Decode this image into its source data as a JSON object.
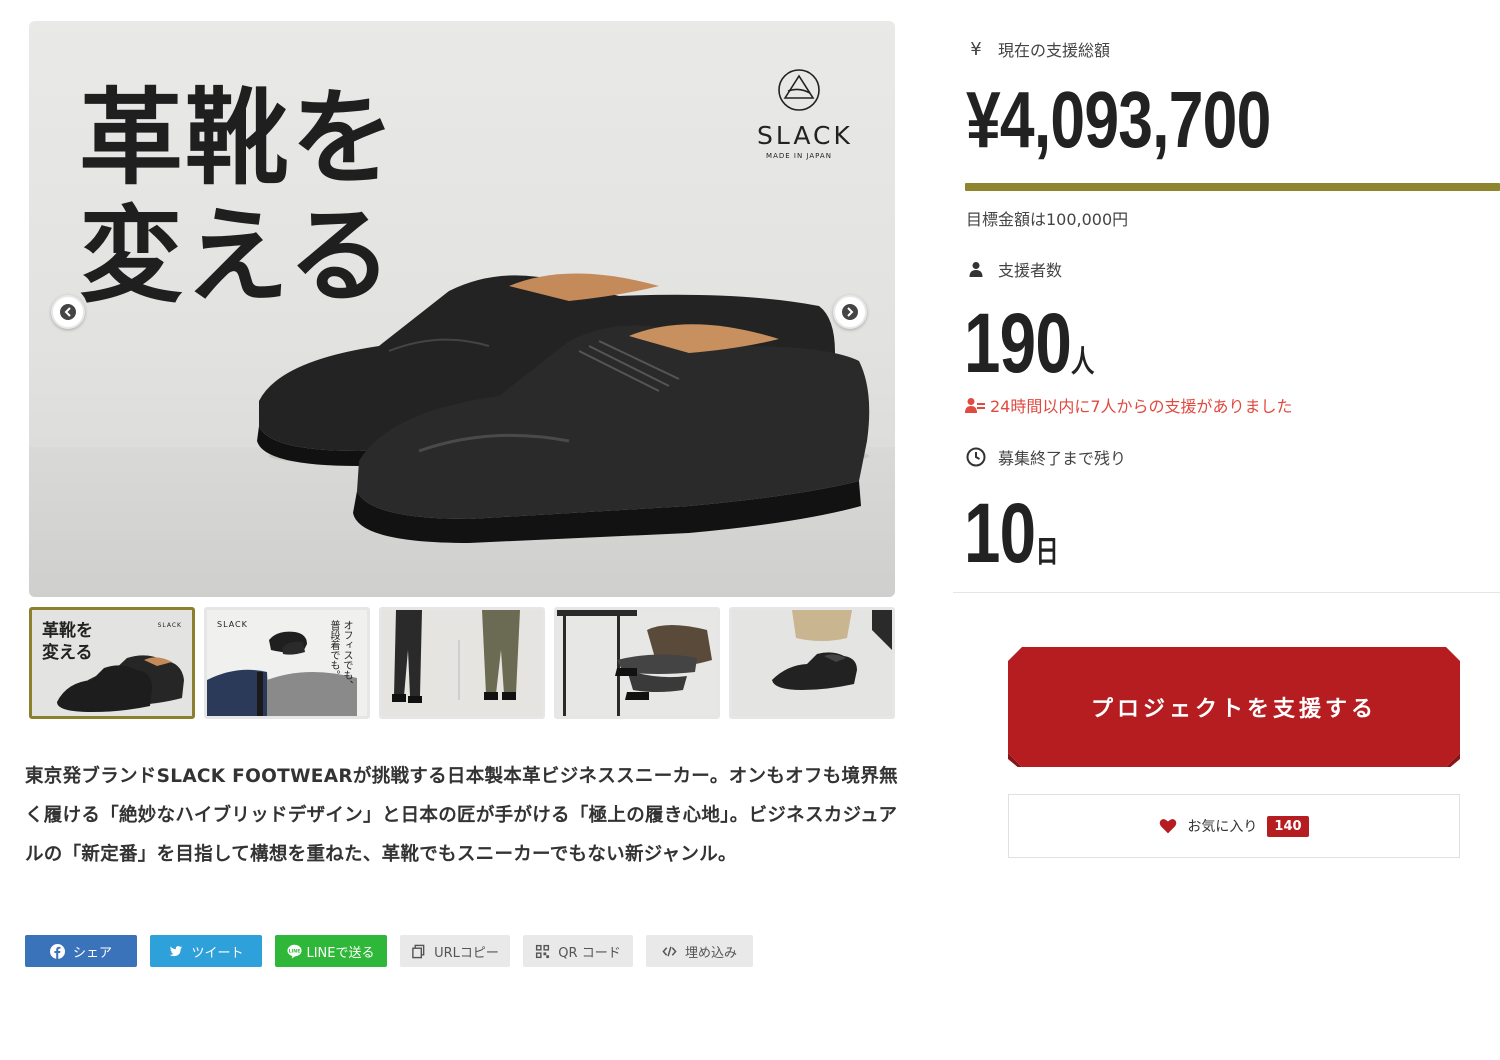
{
  "hero": {
    "headline": "革靴を\n変える",
    "logo_name": "SLACK",
    "logo_sub": "MADE IN JAPAN"
  },
  "thumbnails": [
    {
      "text": "革靴を\n変える",
      "logo": "SLACK"
    },
    {
      "logo": "SLACK",
      "vertical_text": "オフィスでも、\n普段着でも。"
    },
    {},
    {},
    {}
  ],
  "description": "東京発ブランドSLACK FOOTWEARが挑戦する日本製本革ビジネススニーカー。オンもオフも境界無く履ける「絶妙なハイブリッドデザイン」と日本の匠が手がける「極上の履き心地」。ビジネスカジュアルの「新定番」を目指して構想を重ねた、革靴でもスニーカーでもない新ジャンル。",
  "share": {
    "facebook": "シェア",
    "twitter": "ツイート",
    "line": "LINEで送る",
    "url": "URLコピー",
    "qr": "QR コード",
    "embed": "埋め込み"
  },
  "stats": {
    "yen_symbol": "¥",
    "total_label": "現在の支援総額",
    "total_value": "¥4,093,700",
    "progress_percent": 100,
    "goal_text": "目標金額は100,000円",
    "backers_label": "支援者数",
    "backers_value": "190",
    "backers_unit": "人",
    "recent_text": "24時間以内に7人からの支援がありました",
    "remaining_label": "募集終了まで残り",
    "remaining_value": "10",
    "remaining_unit": "日"
  },
  "actions": {
    "support_button": "プロジェクトを支援する",
    "favorite_label": "お気に入り",
    "favorite_count": "140"
  },
  "colors": {
    "accent_olive": "#8f852f",
    "cta_red": "#b51d21",
    "recent_red": "#e04a3f",
    "facebook": "#3b73bb",
    "twitter": "#2fa1da",
    "line": "#2fb73a"
  }
}
